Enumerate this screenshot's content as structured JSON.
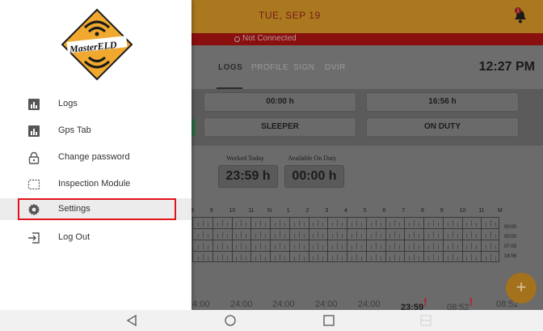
{
  "app": {
    "date": "TUE, SEP 19",
    "connection_status": "Not Connected",
    "notification_count": "1",
    "tabs": [
      {
        "label": "LOGS",
        "active": true
      },
      {
        "label": "PROFILE",
        "active": false
      },
      {
        "label": "SIGN",
        "active": false
      },
      {
        "label": "DVIR",
        "active": false
      }
    ],
    "time": "12:27 PM",
    "status_boxes": {
      "top_left": "00:00 h",
      "top_right": "16:56 h",
      "bottom_left": "SLEEPER",
      "bottom_right": "ON DUTY"
    },
    "worked_today_label": "Worked Today",
    "available_on_duty_label": "Available On Duty",
    "worked_today_value": "23:59 h",
    "available_on_duty_value": "00:00 h",
    "hour_labels": [
      "8",
      "9",
      "10",
      "11",
      "N",
      "1",
      "2",
      "3",
      "4",
      "5",
      "6",
      "7",
      "8",
      "9",
      "10",
      "11",
      "M"
    ],
    "row_totals": [
      "00:00",
      "00:00",
      "07:03",
      "16:56"
    ],
    "bottom_values": [
      {
        "text": "24:00",
        "bold": false,
        "alert": false
      },
      {
        "text": "24:00",
        "bold": false,
        "alert": false
      },
      {
        "text": "24:00",
        "bold": false,
        "alert": false
      },
      {
        "text": "24:00",
        "bold": false,
        "alert": false
      },
      {
        "text": "24:00",
        "bold": false,
        "alert": false
      },
      {
        "text": "23:59",
        "bold": true,
        "alert": true
      },
      {
        "text": "08:52",
        "bold": false,
        "alert": true
      },
      {
        "text": "08:52",
        "bold": false,
        "alert": false
      }
    ],
    "fab_label": "+"
  },
  "drawer": {
    "logo_text": "MasterELD",
    "items": [
      {
        "label": "Logs",
        "icon": "bar-chart-icon"
      },
      {
        "label": "Gps Tab",
        "icon": "bar-chart-icon"
      },
      {
        "label": "Change password",
        "icon": "lock-icon"
      },
      {
        "label": "Inspection Module",
        "icon": "inspection-icon"
      },
      {
        "label": "Settings",
        "icon": "gear-icon",
        "active": true
      },
      {
        "label": "Log Out",
        "icon": "logout-icon"
      }
    ]
  },
  "colors": {
    "brand": "#f0a92e",
    "alert": "#e0141a"
  }
}
